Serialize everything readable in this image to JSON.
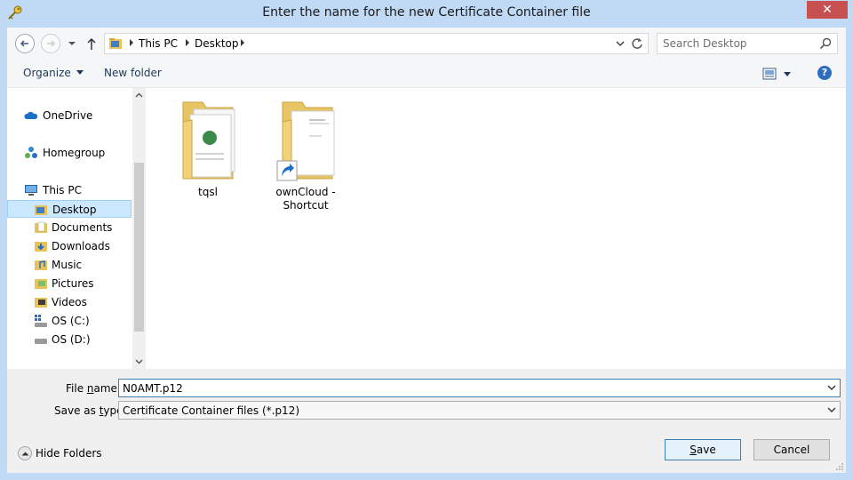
{
  "window": {
    "title": "Enter the name for the new Certificate Container file",
    "close_label": "✕"
  },
  "address": {
    "crumbs": [
      "This PC",
      "Desktop"
    ]
  },
  "search": {
    "placeholder": "Search Desktop"
  },
  "toolbar": {
    "organize_label": "Organize",
    "new_folder_label": "New folder",
    "help_label": "?"
  },
  "nav_pane": {
    "items": [
      {
        "label": "OneDrive",
        "icon": "onedrive-icon"
      },
      {
        "label": "Homegroup",
        "icon": "homegroup-icon"
      },
      {
        "label": "This PC",
        "icon": "computer-icon"
      },
      {
        "label": "Desktop",
        "icon": "desktop-folder-icon",
        "selected": true
      },
      {
        "label": "Documents",
        "icon": "documents-folder-icon"
      },
      {
        "label": "Downloads",
        "icon": "downloads-folder-icon"
      },
      {
        "label": "Music",
        "icon": "music-folder-icon"
      },
      {
        "label": "Pictures",
        "icon": "pictures-folder-icon"
      },
      {
        "label": "Videos",
        "icon": "videos-folder-icon"
      },
      {
        "label": "OS (C:)",
        "icon": "system-drive-icon"
      },
      {
        "label": "OS (D:)",
        "icon": "drive-icon"
      }
    ]
  },
  "files": [
    {
      "name": "tqsl",
      "type": "folder"
    },
    {
      "name_line1": "ownCloud -",
      "name_line2": "Shortcut",
      "type": "shortcut"
    }
  ],
  "form": {
    "file_name_label_pre": "File ",
    "file_name_label_u": "n",
    "file_name_label_post": "ame:",
    "file_name_value": "N0AMT.p12",
    "save_type_label_pre": "Save as ",
    "save_type_label_u": "t",
    "save_type_label_post": "ype:",
    "save_type_value": "Certificate Container files (*.p12)"
  },
  "footer": {
    "hide_folders_label": "Hide Folders",
    "save_label_u": "S",
    "save_label_rest": "ave",
    "cancel_label": "Cancel"
  },
  "colors": {
    "frame": "#c0d9f5",
    "close": "#c75050",
    "selection": "#cce8ff",
    "accent": "#3c7fb1"
  }
}
